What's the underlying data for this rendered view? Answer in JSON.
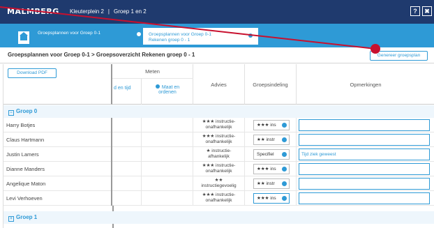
{
  "header": {
    "logo": "MALMBERG",
    "crumb_left": "Kleuterplein 2",
    "crumb_sep": "|",
    "crumb_right": "Groep 1 en 2",
    "help_label": "?",
    "close_label": "✖"
  },
  "tabs": [
    {
      "label": "Groepsplannen voor Groep 0-1"
    },
    {
      "label_line1": "Groepsplannen voor Groep 0-1",
      "label_line2": "Rekenen groep 0 - 1"
    }
  ],
  "page": {
    "title": "Groepsplannen voor Groep 0-1 > Groepsoverzicht Rekenen groep 0 - 1",
    "generate_button": "Genereer groepsplan",
    "download_button": "Download PDF"
  },
  "columns": {
    "meten": "Meten",
    "sub_left": "d en tijd",
    "sub_right_line1": "Maat en",
    "sub_right_line2": "ordenen",
    "advies": "Advies",
    "groepsindeling": "Groepsindeling",
    "opmerkingen": "Opmerkingen"
  },
  "groups": [
    {
      "label": "Groep 0",
      "toggle": "−"
    },
    {
      "label": "Groep 1",
      "toggle": "+"
    }
  ],
  "rows": [
    {
      "name": "Harry Botjes",
      "advies1": "★★★ instructie-",
      "advies2": "onafhankelijk",
      "groep": "★★★ ins",
      "opm": ""
    },
    {
      "name": "Claus Hartmann",
      "advies1": "★★★ instructie-",
      "advies2": "onafhankelijk",
      "groep": "★★ instr",
      "opm": ""
    },
    {
      "name": "Justin Lamers",
      "advies1": "★ instructie-",
      "advies2": "afhankelijk",
      "groep": "Specifiel",
      "opm": "Tijd ziek geweest"
    },
    {
      "name": "Dianne Manders",
      "advies1": "★★★ instructie-",
      "advies2": "onafhankelijk",
      "groep": "★★★ ins",
      "opm": ""
    },
    {
      "name": "Angelique Maton",
      "advies1": "★★",
      "advies2": "instructiegevoelig",
      "groep": "★★ instr",
      "opm": ""
    },
    {
      "name": "Levi Verhoeven",
      "advies1": "★★★ instructie-",
      "advies2": "onafhankelijk",
      "groep": "★★★ ins",
      "opm": ""
    }
  ],
  "colors": {
    "topbar": "#1f3a6e",
    "accent": "#2e9ad6",
    "annotation": "#c8102e"
  }
}
